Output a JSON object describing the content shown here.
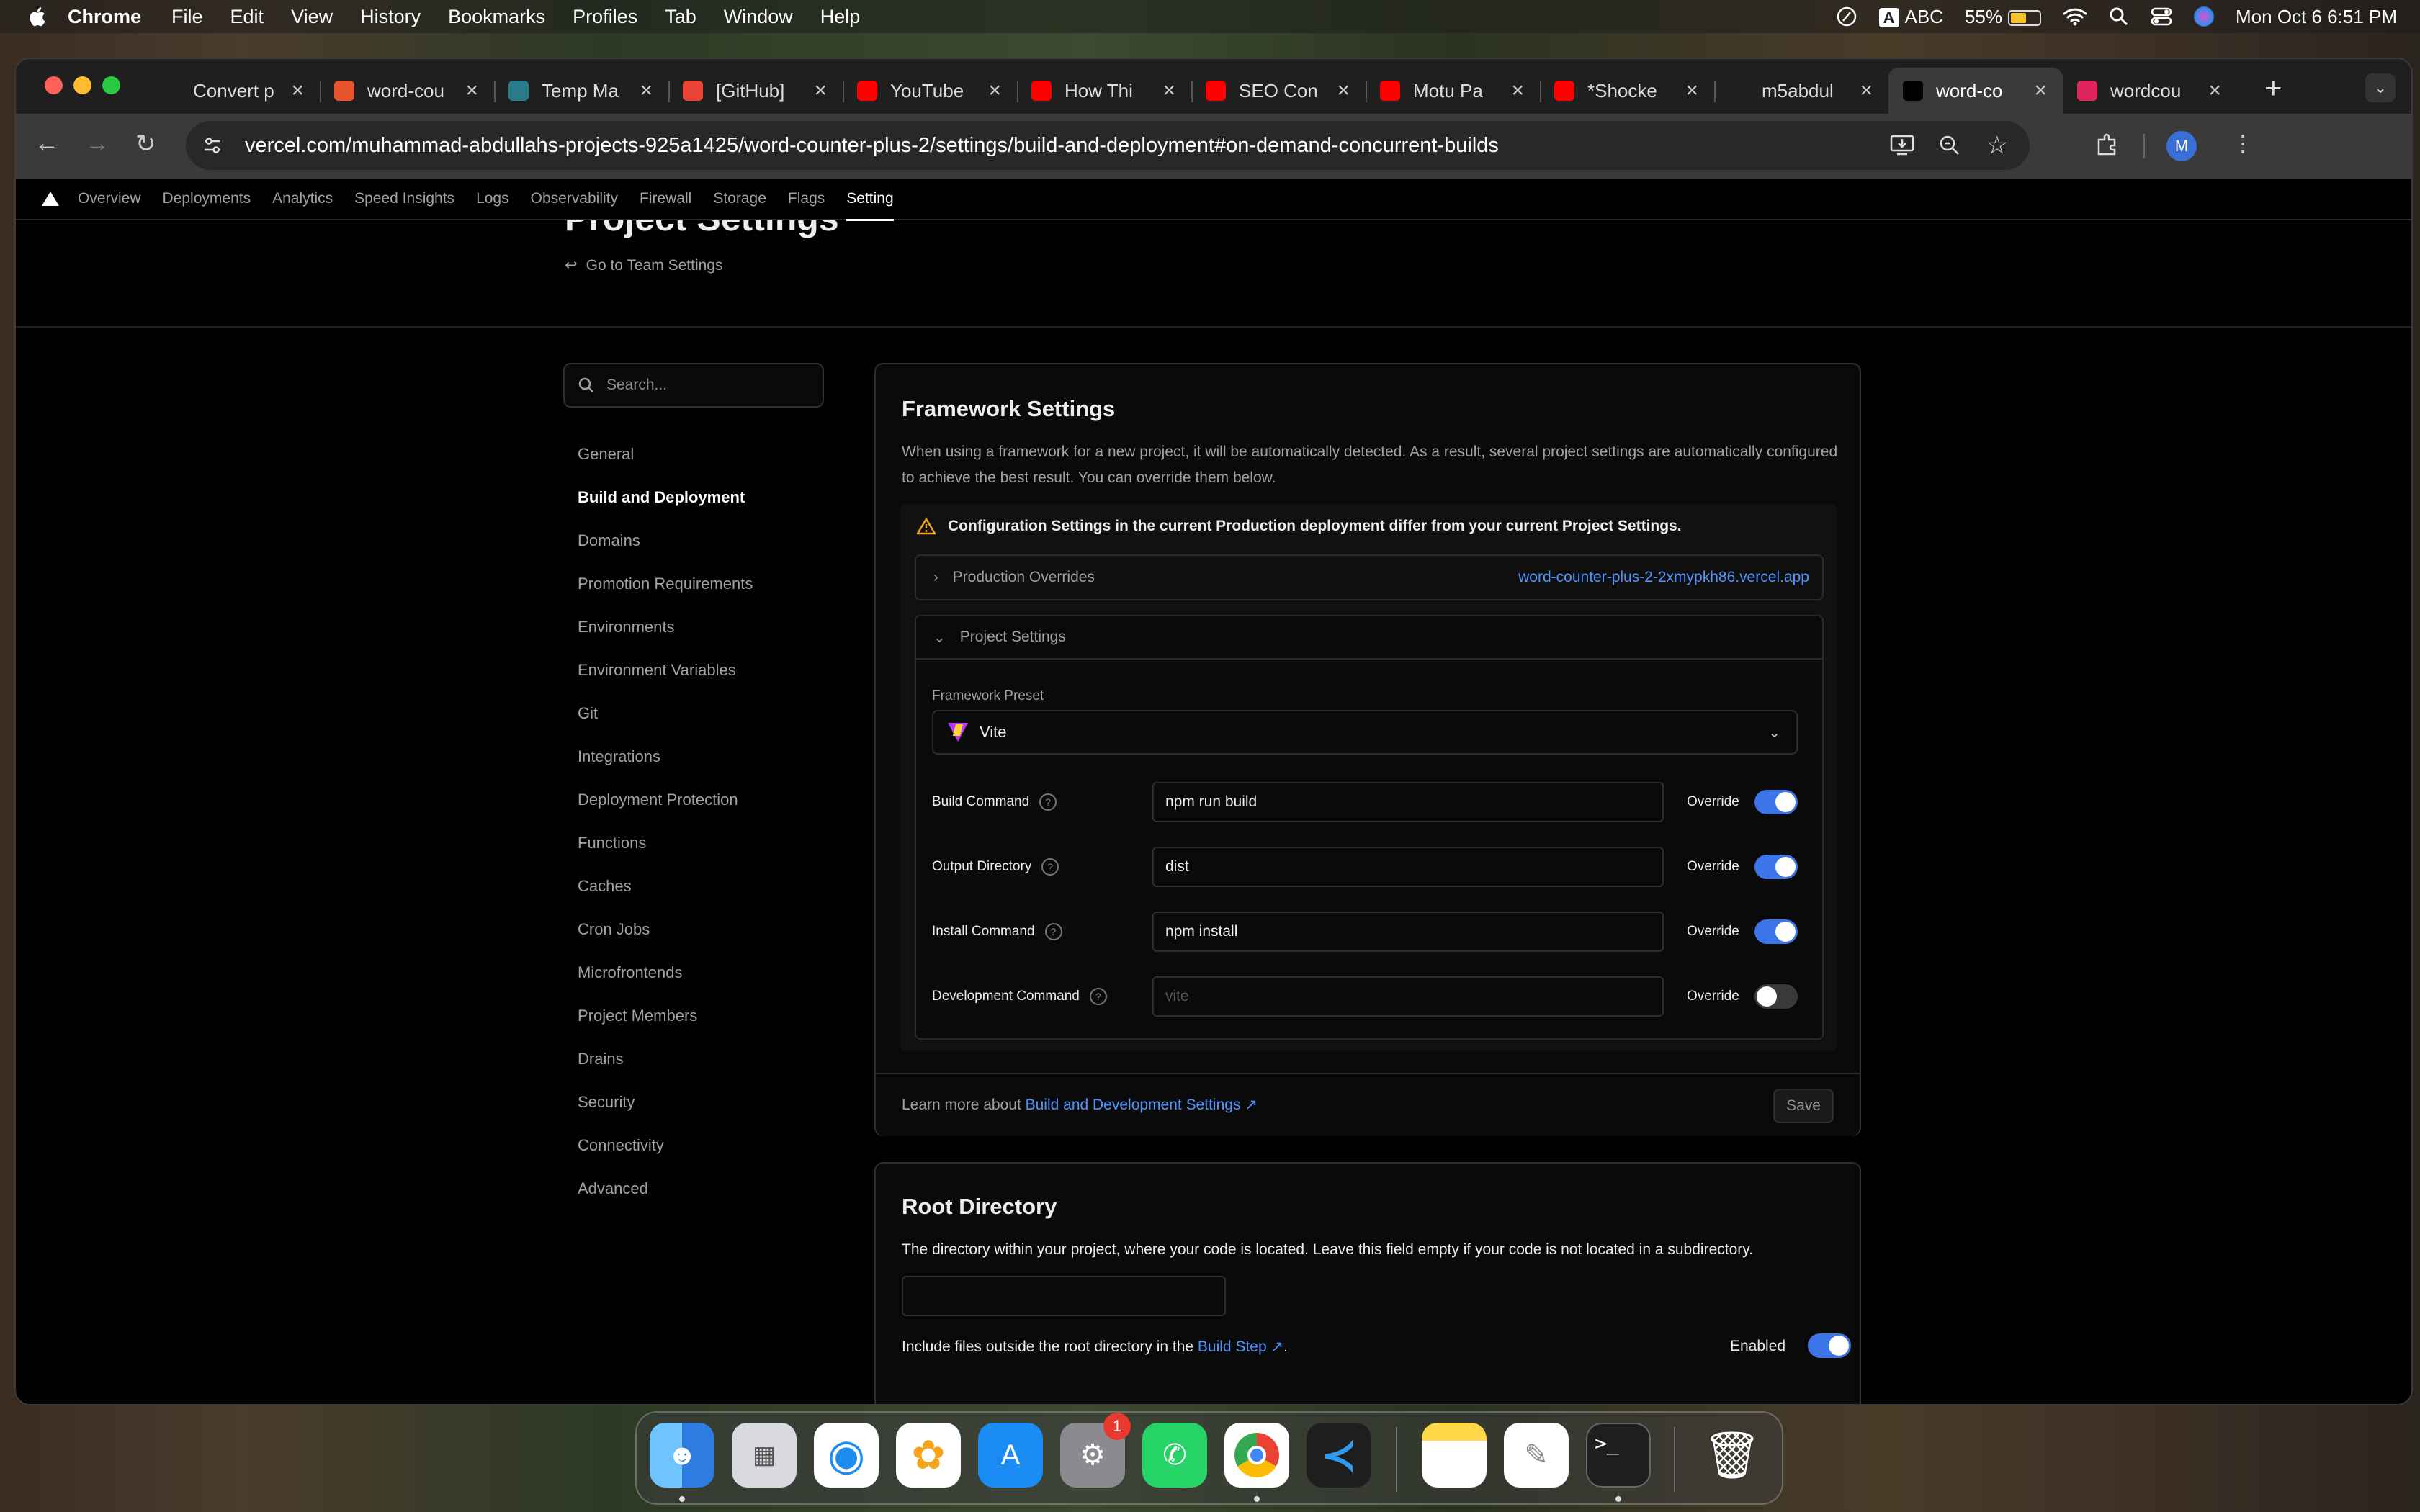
{
  "menubar": {
    "app": "Chrome",
    "items": [
      "File",
      "Edit",
      "View",
      "History",
      "Bookmarks",
      "Profiles",
      "Tab",
      "Window",
      "Help"
    ],
    "input_source": "ABC",
    "input_badge": "A",
    "battery": "55%",
    "battery_level": 0.55,
    "datetime": "Mon Oct 6  6:51 PM"
  },
  "tabs": [
    {
      "label": "Convert p",
      "icon": "openai-icon",
      "color": "#1f1f1f"
    },
    {
      "label": "word-cou",
      "icon": "orange-logo-icon",
      "color": "#e8552d"
    },
    {
      "label": "Temp Ma",
      "icon": "globe-icon",
      "color": "#2a7b8c"
    },
    {
      "label": "[GitHub]",
      "icon": "gmail-icon",
      "color": "#ea4335"
    },
    {
      "label": "YouTube",
      "icon": "youtube-icon",
      "color": "#ff0000"
    },
    {
      "label": "How Thi",
      "icon": "youtube-icon",
      "color": "#ff0000"
    },
    {
      "label": "SEO Con",
      "icon": "youtube-icon",
      "color": "#ff0000"
    },
    {
      "label": "Motu Pa",
      "icon": "youtube-icon",
      "color": "#ff0000"
    },
    {
      "label": "*Shocke",
      "icon": "youtube-icon",
      "color": "#ff0000"
    },
    {
      "label": "m5abdul",
      "icon": "github-icon",
      "color": "#1f1f1f"
    },
    {
      "label": "word-co",
      "icon": "vercel-icon",
      "color": "#000000",
      "active": true
    },
    {
      "label": "wordcou",
      "icon": "rocket-icon",
      "color": "#e0245e"
    }
  ],
  "toolbar": {
    "url": "vercel.com/muhammad-abdullahs-projects-925a1425/word-counter-plus-2/settings/build-and-deployment#on-demand-concurrent-builds",
    "profile_initial": "M"
  },
  "subnav": [
    "Overview",
    "Deployments",
    "Analytics",
    "Speed Insights",
    "Logs",
    "Observability",
    "Firewall",
    "Storage",
    "Flags",
    "Setting"
  ],
  "page": {
    "title": "Project Settings",
    "back_link": "Go to Team Settings",
    "search_placeholder": "Search..."
  },
  "sidenav": [
    "General",
    "Build and Deployment",
    "Domains",
    "Promotion Requirements",
    "Environments",
    "Environment Variables",
    "Git",
    "Integrations",
    "Deployment Protection",
    "Functions",
    "Caches",
    "Cron Jobs",
    "Microfrontends",
    "Project Members",
    "Drains",
    "Security",
    "Connectivity",
    "Advanced"
  ],
  "framework": {
    "title": "Framework Settings",
    "description": "When using a framework for a new project, it will be automatically detected. As a result, several project settings are automatically configured to achieve the best result. You can override them below.",
    "warning": "Configuration Settings in the current Production deployment differ from your current Project Settings.",
    "production_overrides": "Production Overrides",
    "production_link": "word-counter-plus-2-2xmypkh86.vercel.app",
    "project_settings": "Project Settings",
    "preset_label": "Framework Preset",
    "preset_value": "Vite",
    "override_label": "Override",
    "rows": [
      {
        "label": "Build Command",
        "value": "npm run build",
        "placeholder": "",
        "override": true
      },
      {
        "label": "Output Directory",
        "value": "dist",
        "placeholder": "",
        "override": true
      },
      {
        "label": "Install Command",
        "value": "npm install",
        "placeholder": "",
        "override": true
      },
      {
        "label": "Development Command",
        "value": "",
        "placeholder": "vite",
        "override": false
      }
    ],
    "learn_prefix": "Learn more about ",
    "learn_link": "Build and Development Settings",
    "save": "Save"
  },
  "root": {
    "title": "Root Directory",
    "description": "The directory within your project, where your code is located. Leave this field empty if your code is not located in a subdirectory.",
    "include_prefix": "Include files outside the root directory in the ",
    "include_link": "Build Step",
    "include_suffix": ".",
    "enabled_label": "Enabled",
    "enabled": true
  },
  "dock": {
    "apps": [
      "Finder",
      "Launchpad",
      "Safari",
      "Photos",
      "App Store",
      "System Settings",
      "WhatsApp",
      "Chrome",
      "VS Code",
      "Notes",
      "TextEdit",
      "Terminal",
      "Trash"
    ],
    "settings_badge": "1"
  }
}
